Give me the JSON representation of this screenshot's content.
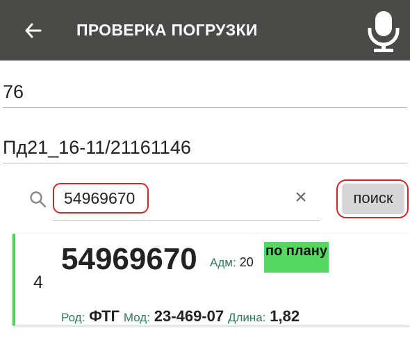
{
  "appbar": {
    "title": "ПРОВЕРКА ПОГРУЗКИ",
    "back_icon": "arrow-left-icon",
    "mic_icon": "microphone-icon"
  },
  "fields": {
    "field1_value": "76",
    "field2_value": "Пд21_16-11/21161146"
  },
  "search": {
    "value": "54969670",
    "clear_glyph": "×",
    "button_label": "поиск"
  },
  "result": {
    "index": "4",
    "code": "54969670",
    "adm_label": "Адм:",
    "adm_value": "20",
    "status": "по плану",
    "rod_label": "Род:",
    "rod_value": "ФТГ",
    "mod_label": "Мод:",
    "mod_value": "23-469-07",
    "length_label": "Длина:",
    "length_value": "1,82"
  },
  "colors": {
    "appbar_bg": "#4a4a48",
    "highlight_red": "#d2262a",
    "status_green": "#55d85f",
    "label_green": "#2f7a57"
  }
}
